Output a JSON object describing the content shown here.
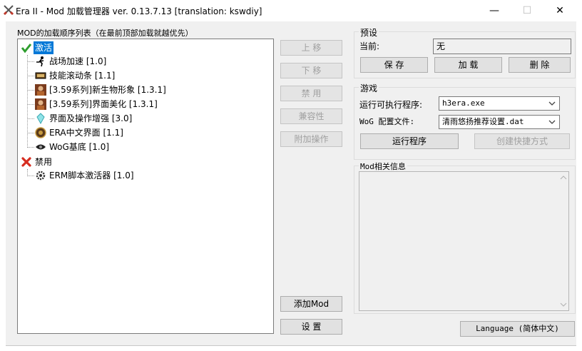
{
  "window": {
    "title": "Era II - Mod 加载管理器 ver. 0.13.7.13 [translation: kswdiy]",
    "minimize": "—",
    "maximize": "☐",
    "close": "✕"
  },
  "mod_list": {
    "label": "MOD的加载顺序列表（在最前顶部加载就越优先）",
    "groups": [
      {
        "label": "激活",
        "icon": "green-check-icon",
        "items": [
          {
            "label": "战场加速 [1.0]",
            "icon": "runner-icon"
          },
          {
            "label": "技能滚动条 [1.1]",
            "icon": "scroll-bar-icon"
          },
          {
            "label": "[3.59系列]新生物形象 [1.3.1]",
            "icon": "creature-portrait-icon"
          },
          {
            "label": "[3.59系列]界面美化 [1.3.1]",
            "icon": "creature-portrait-icon"
          },
          {
            "label": "界面及操作增强 [3.0]",
            "icon": "crystal-icon"
          },
          {
            "label": "ERA中文界面 [1.1]",
            "icon": "shield-emblem-icon"
          },
          {
            "label": "WoG基底 [1.0]",
            "icon": "eye-icon"
          }
        ]
      },
      {
        "label": "禁用",
        "icon": "red-x-icon",
        "items": [
          {
            "label": "ERM脚本激活器 [1.0]",
            "icon": "gear-icon"
          }
        ]
      }
    ]
  },
  "side_buttons": {
    "move_up": "上 移",
    "move_down": "下 移",
    "disable": "禁 用",
    "compat": "兼容性",
    "extra": "附加操作",
    "add_mod": "添加Mod",
    "settings": "设 置"
  },
  "preset": {
    "title": "预设",
    "current_label": "当前:",
    "current_value": "无",
    "save": "保 存",
    "load": "加 载",
    "delete": "删 除"
  },
  "game": {
    "title": "游戏",
    "exe_label": "运行可执行程序:",
    "exe_value": "h3era.exe",
    "wog_label": "WoG 配置文件:",
    "wog_value": "清雨悠扬推荐设置.dat",
    "run": "运行程序",
    "shortcut": "创建快捷方式"
  },
  "mod_info": {
    "title": "Mod相关信息",
    "content": ""
  },
  "language_button": "Language (简体中文)",
  "colors": {
    "client_bg": "#f0f0f0",
    "selection": "#0078d7"
  }
}
